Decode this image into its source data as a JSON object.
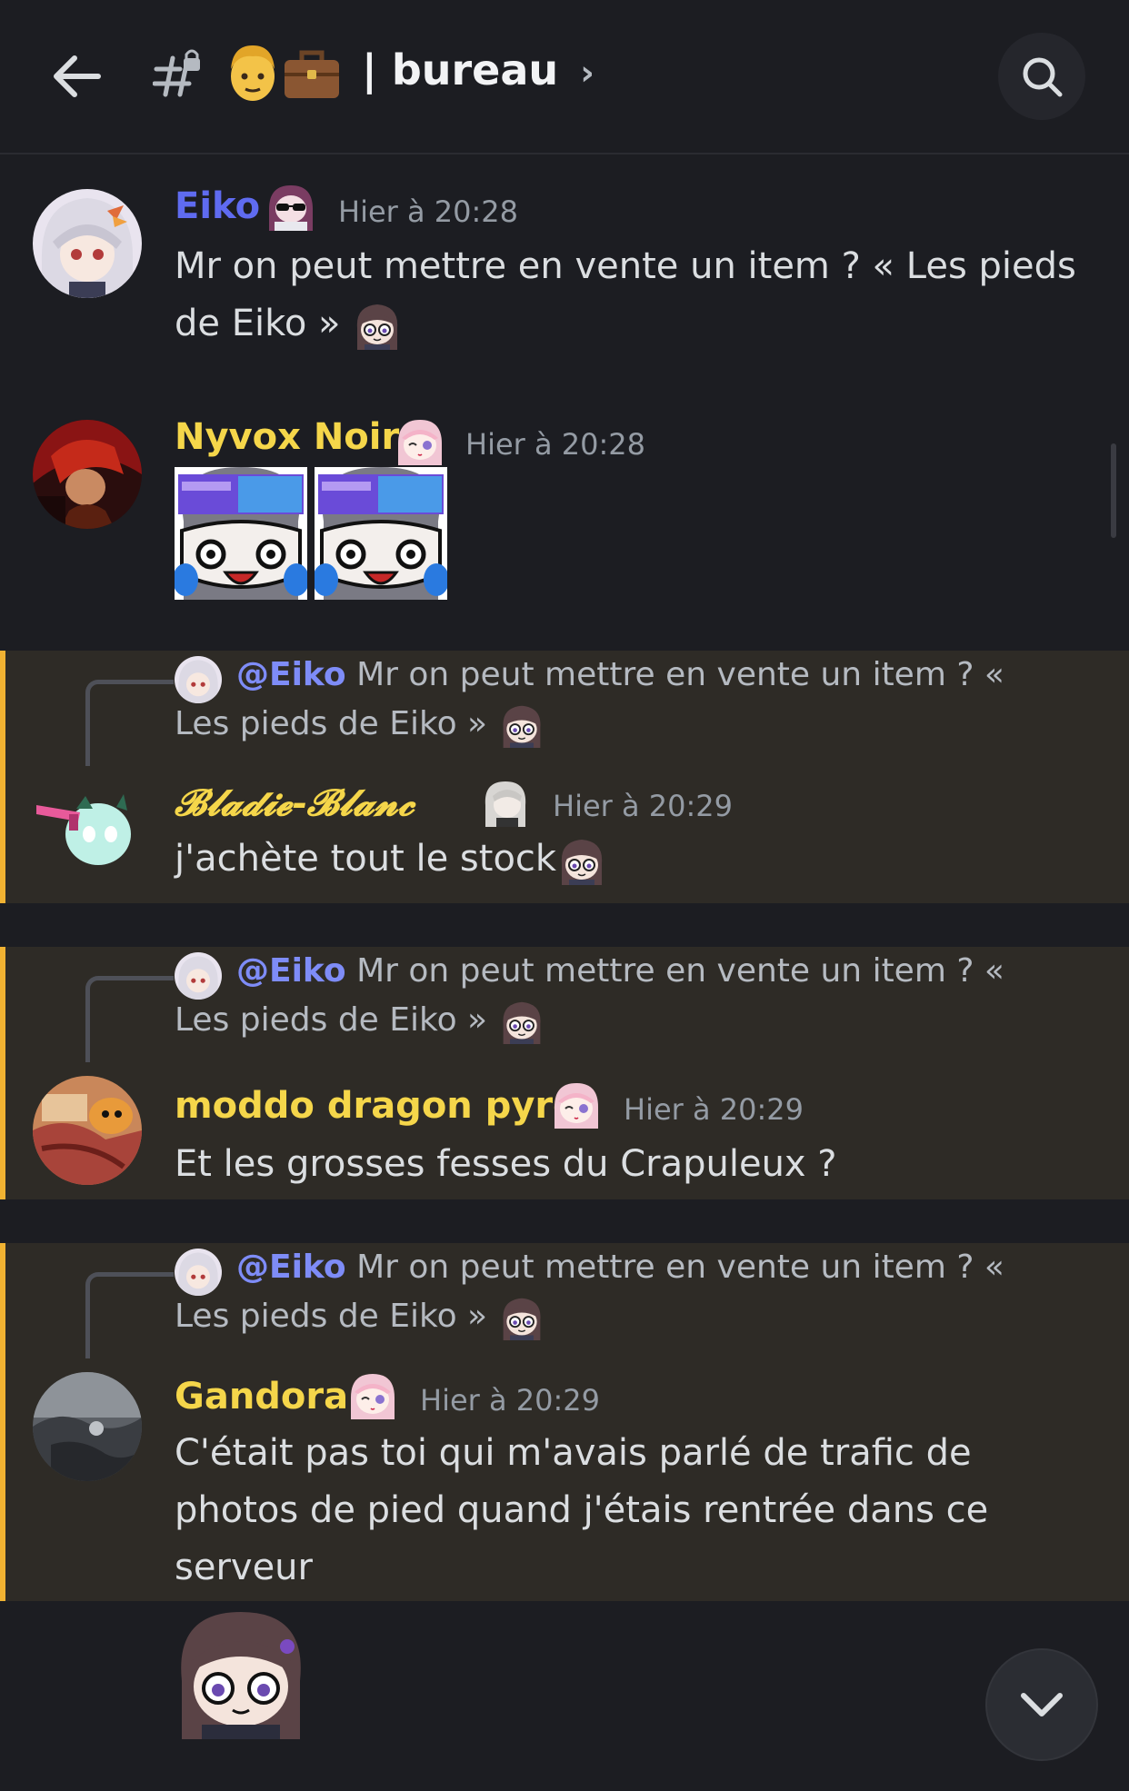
{
  "header": {
    "back_icon": "arrow-left-icon",
    "channel_icon": "locked-hash-icon",
    "channel_emojis": [
      "man-face-emoji",
      "briefcase-emoji"
    ],
    "channel_name": "| bureau",
    "chevron": "›",
    "search_icon": "search-icon"
  },
  "messages": [
    {
      "author": "Eiko",
      "author_color": "#5f6bf0",
      "time": "Hier à 20:28",
      "text": "Mr on peut mettre en vente un item ? « Les pieds de Eiko »"
    },
    {
      "author": "Nyvox Noir",
      "author_color": "#f5d64a",
      "time": "Hier à 20:28",
      "stickers": [
        "vr-goggles-face-emote",
        "vr-goggles-face-emote"
      ]
    },
    {
      "reply_mention": "@Eiko",
      "reply_text": "Mr on peut mettre en vente un item ? « Les pieds de Eiko »",
      "author": "𝓑𝓵𝓪𝓭𝓲𝓮-𝓑𝓵𝓪𝓷𝓬",
      "author_color": "#f5d64a",
      "time": "Hier à 20:29",
      "text": "j'achète tout le stock"
    },
    {
      "reply_mention": "@Eiko",
      "reply_text": "Mr on peut mettre en vente un item ? « Les pieds de Eiko »",
      "author": "moddo dragon pyro",
      "author_color": "#f5d64a",
      "time": "Hier à 20:29",
      "text": "Et les grosses fesses du Crapuleux ?"
    },
    {
      "reply_mention": "@Eiko",
      "reply_text": "Mr on peut mettre en vente un item ? « Les pieds de Eiko »",
      "author": "Gandora",
      "author_color": "#f5d64a",
      "time": "Hier à 20:29",
      "text": "C'était pas toi qui m'avais parlé de trafic de photos de pied quand j'étais rentrée dans ce serveur"
    }
  ],
  "footer": {
    "scroll_down_icon": "chevron-down-icon"
  },
  "colors": {
    "background": "#1c1d22",
    "highlight": "#2e2b26",
    "highlight_bar": "#f0b232",
    "mention": "#7e8cf7"
  }
}
